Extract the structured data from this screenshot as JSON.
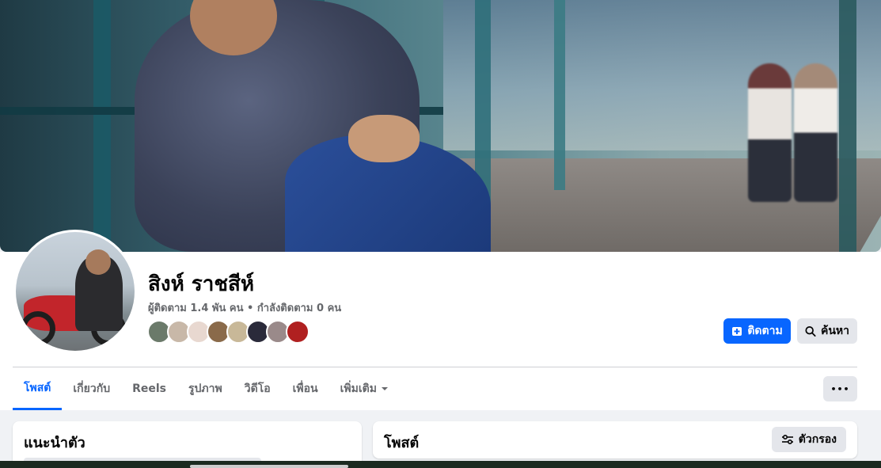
{
  "profile": {
    "name": "สิงห์ ราชสีห์",
    "stats": "ผู้ติดตาม 1.4 พัน คน • กำลังติดตาม 0 คน",
    "friend_colors": [
      "#6b7a6a",
      "#c8b8a8",
      "#e8d8d0",
      "#8a6a4a",
      "#c8b898",
      "#2a2a3a",
      "#9a8a8a",
      "#b02020"
    ]
  },
  "actions": {
    "follow_label": "ติดตาม",
    "search_label": "ค้นหา",
    "more_label": "•••"
  },
  "tabs": [
    {
      "label": "โพสต์"
    },
    {
      "label": "เกี่ยวกับ"
    },
    {
      "label": "Reels"
    },
    {
      "label": "รูปภาพ"
    },
    {
      "label": "วิดีโอ"
    },
    {
      "label": "เพื่อน"
    },
    {
      "label": "เพิ่มเติม"
    }
  ],
  "intro": {
    "title": "แนะนำตัว"
  },
  "posts": {
    "title": "โพสต์",
    "filter_label": "ตัวกรอง"
  },
  "colors": {
    "accent": "#0866ff",
    "secondary_bg": "#e4e6eb",
    "page_bg": "#f0f2f5"
  }
}
